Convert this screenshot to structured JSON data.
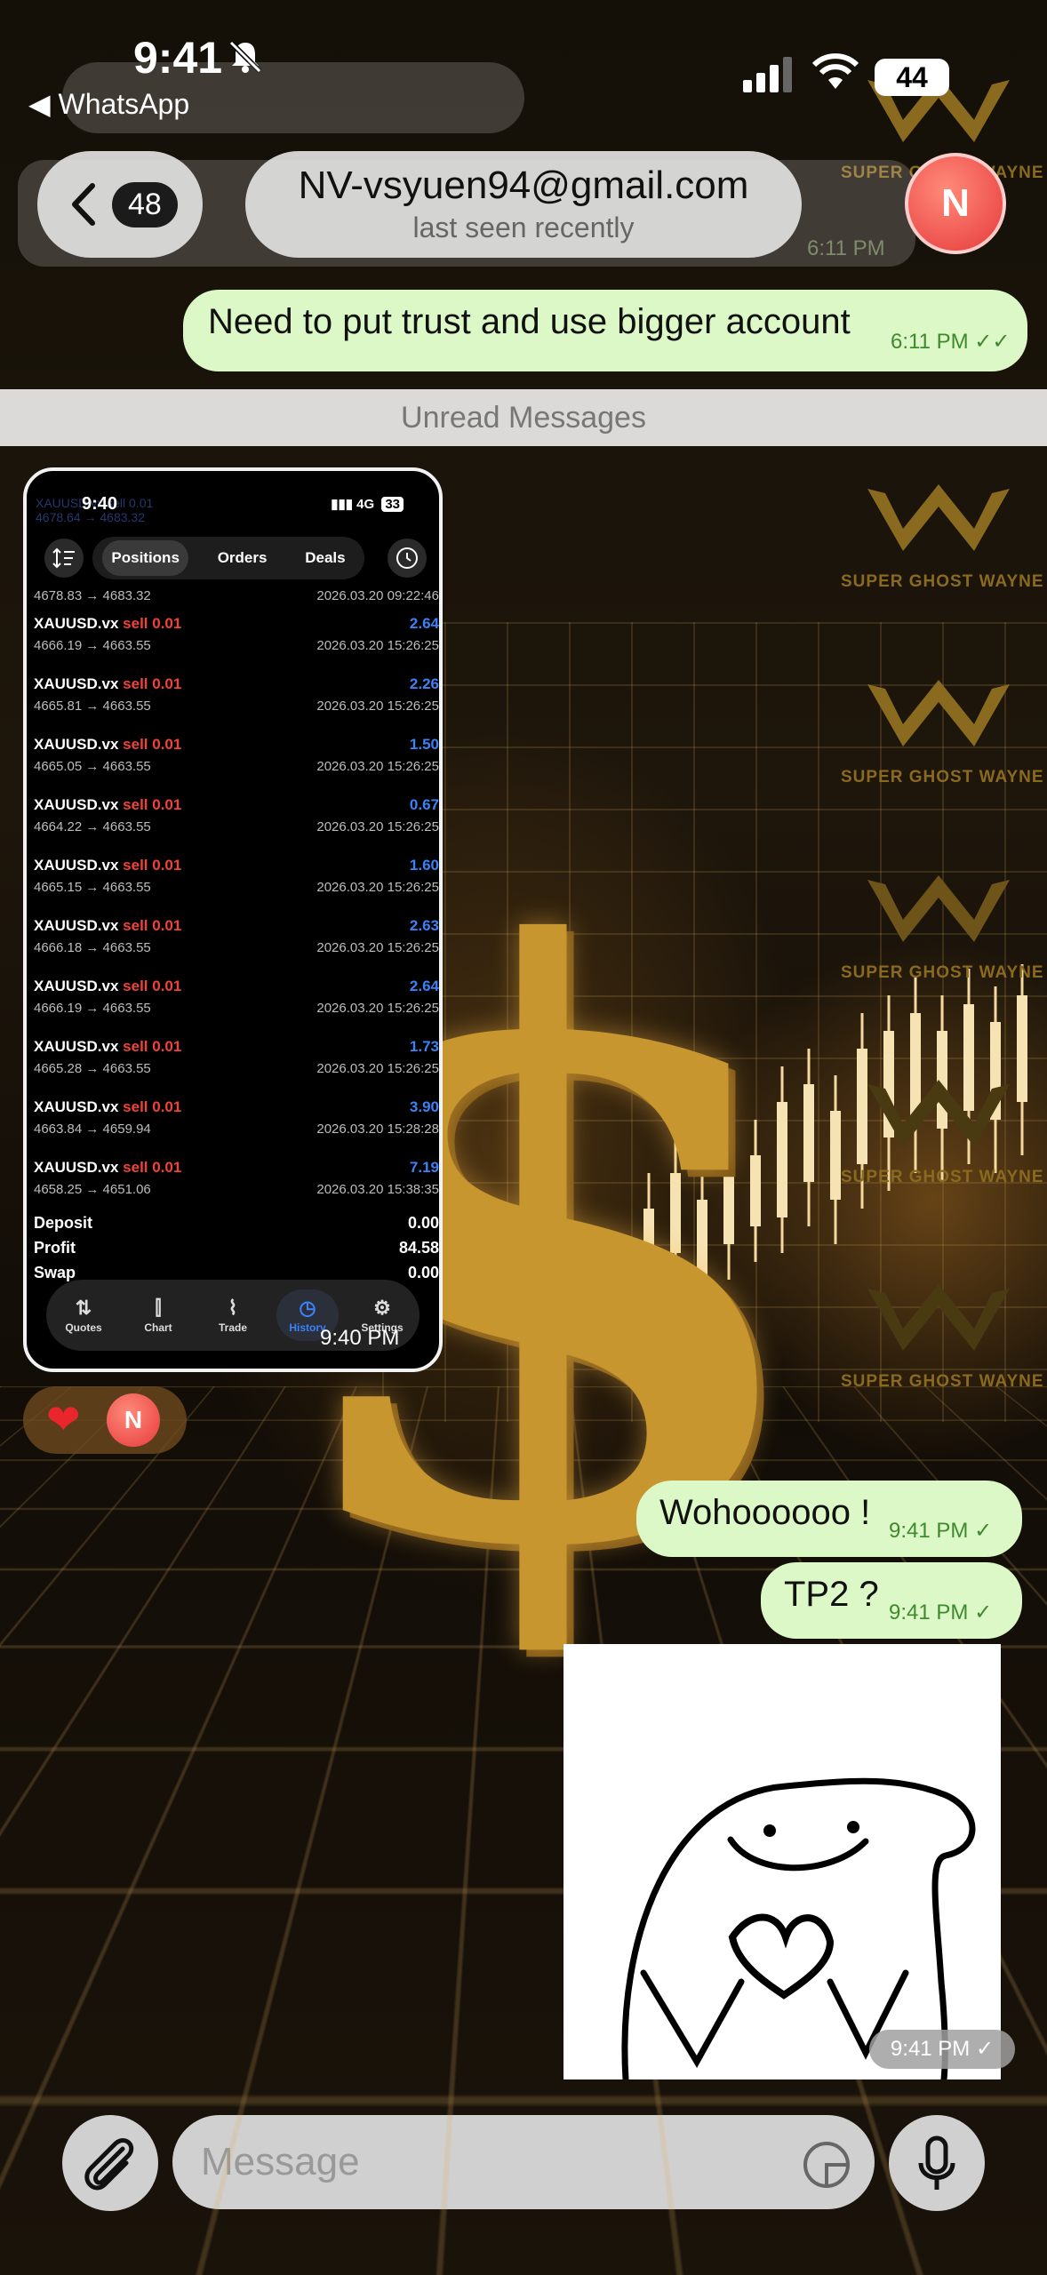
{
  "status_bar": {
    "time": "9:41",
    "back_app": "◀ WhatsApp",
    "battery": "44"
  },
  "header": {
    "back_count": "48",
    "contact_name": "NV-vsyuen94@gmail.com",
    "contact_status": "last seen recently",
    "avatar_initial": "N"
  },
  "messages": {
    "prev_incoming_time": "6:11 PM",
    "out1": {
      "text": "Need to put trust and use bigger account",
      "time": "6:11 PM",
      "ticks": "✓✓"
    },
    "unread_label": "Unread Messages",
    "out2": {
      "text": "Wohoooooo !",
      "time": "9:41 PM",
      "ticks": "✓"
    },
    "out3": {
      "text": "TP2 ?",
      "time": "9:41 PM",
      "ticks": "✓"
    },
    "sticker_time": "9:41 PM ✓"
  },
  "reaction": {
    "emoji": "❤",
    "avatar_initial": "N"
  },
  "screenshot": {
    "time": "9:40",
    "network": "4G",
    "battery": "33",
    "tabs": [
      "Positions",
      "Orders",
      "Deals"
    ],
    "active_tab": "Positions",
    "ghost_rows": [
      "XAUUSD.vx sell 0.01",
      "4678.64 → 4683.32",
      "2026.03.20 09:22:46"
    ],
    "rows": [
      {
        "symbol": "XAUUSD.vx",
        "side": "sell 0.01",
        "profit": "",
        "prices": "4678.83 → 4683.32",
        "date": "2026.03.20 09:22:46"
      },
      {
        "symbol": "XAUUSD.vx",
        "side": "sell 0.01",
        "profit": "2.64",
        "prices": "4666.19 → 4663.55",
        "date": "2026.03.20 15:26:25"
      },
      {
        "symbol": "XAUUSD.vx",
        "side": "sell 0.01",
        "profit": "2.26",
        "prices": "4665.81 → 4663.55",
        "date": "2026.03.20 15:26:25"
      },
      {
        "symbol": "XAUUSD.vx",
        "side": "sell 0.01",
        "profit": "1.50",
        "prices": "4665.05 → 4663.55",
        "date": "2026.03.20 15:26:25"
      },
      {
        "symbol": "XAUUSD.vx",
        "side": "sell 0.01",
        "profit": "0.67",
        "prices": "4664.22 → 4663.55",
        "date": "2026.03.20 15:26:25"
      },
      {
        "symbol": "XAUUSD.vx",
        "side": "sell 0.01",
        "profit": "1.60",
        "prices": "4665.15 → 4663.55",
        "date": "2026.03.20 15:26:25"
      },
      {
        "symbol": "XAUUSD.vx",
        "side": "sell 0.01",
        "profit": "2.63",
        "prices": "4666.18 → 4663.55",
        "date": "2026.03.20 15:26:25"
      },
      {
        "symbol": "XAUUSD.vx",
        "side": "sell 0.01",
        "profit": "2.64",
        "prices": "4666.19 → 4663.55",
        "date": "2026.03.20 15:26:25"
      },
      {
        "symbol": "XAUUSD.vx",
        "side": "sell 0.01",
        "profit": "1.73",
        "prices": "4665.28 → 4663.55",
        "date": "2026.03.20 15:26:25"
      },
      {
        "symbol": "XAUUSD.vx",
        "side": "sell 0.01",
        "profit": "3.90",
        "prices": "4663.84 → 4659.94",
        "date": "2026.03.20 15:28:28"
      },
      {
        "symbol": "XAUUSD.vx",
        "side": "sell 0.01",
        "profit": "7.19",
        "prices": "4658.25 → 4651.06",
        "date": "2026.03.20 15:38:35"
      }
    ],
    "summary": [
      {
        "label": "Deposit",
        "value": "0.00"
      },
      {
        "label": "Profit",
        "value": "84.58"
      },
      {
        "label": "Swap",
        "value": "0.00"
      }
    ],
    "nav": [
      "Quotes",
      "Chart",
      "Trade",
      "History",
      "Settings"
    ],
    "nav_active": "History",
    "timestamp": "9:40 PM"
  },
  "input": {
    "placeholder": "Message"
  },
  "watermark": {
    "text": "SUPER GHOST WAYNE"
  },
  "colors": {
    "bubble_out": "#dcf8c6",
    "tick": "#3f8a2e",
    "profit": "#3b82f6",
    "sell": "#f0433a"
  }
}
